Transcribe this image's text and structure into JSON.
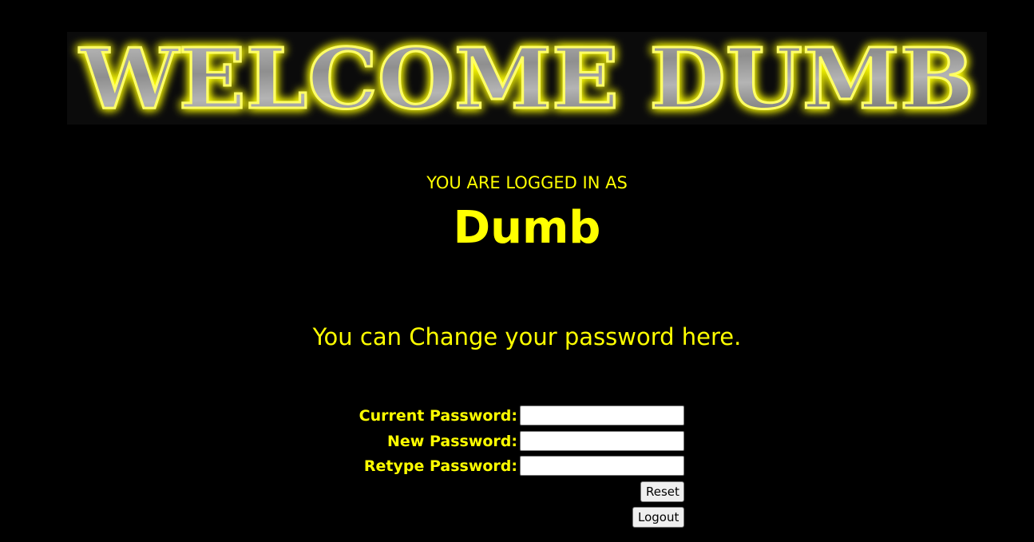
{
  "banner": {
    "text": "WELCOME DUMB",
    "glow_color": "#ffff00",
    "metal_color": "#9a9a9a"
  },
  "session": {
    "label": "YOU ARE LOGGED IN AS",
    "username": "Dumb"
  },
  "message": "You can Change your password here.",
  "form": {
    "current_password_label": "Current Password:",
    "new_password_label": "New Password:",
    "retype_password_label": "Retype Password:",
    "current_password_value": "",
    "new_password_value": "",
    "retype_password_value": "",
    "reset_label": "Reset",
    "logout_label": "Logout"
  },
  "colors": {
    "background": "#000000",
    "text": "#ffff00"
  }
}
